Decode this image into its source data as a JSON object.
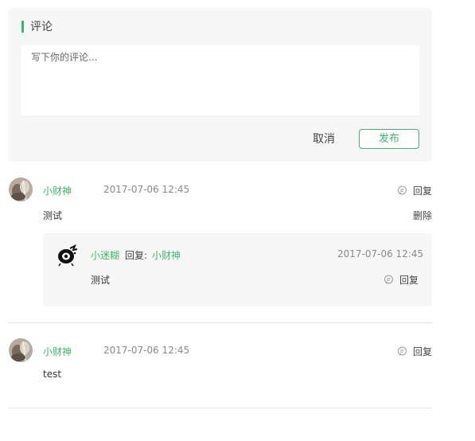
{
  "editor": {
    "title": "评论",
    "placeholder": "写下你的评论...",
    "cancel_label": "取消",
    "publish_label": "发布"
  },
  "comments": [
    {
      "username": "小财神",
      "time": "2017-07-06 12:45",
      "reply_label": "回复",
      "content": "测试",
      "delete_label": "删除",
      "replies": [
        {
          "username": "小迷糊",
          "reply_to_label": "回复:",
          "reply_to_user": "小财神",
          "time": "2017-07-06 12:45",
          "content": "测试",
          "reply_label": "回复"
        }
      ]
    },
    {
      "username": "小财神",
      "time": "2017-07-06 12:45",
      "reply_label": "回复",
      "content": "test"
    }
  ],
  "colors": {
    "accent": "#3fb56b",
    "panel_bg": "#f7f7f7",
    "divider": "#e6e6e6"
  },
  "icons": {
    "reply": "speech-bubble-icon",
    "avatar_user1": "avatar-photo",
    "avatar_user2": "avatar-cartoon"
  }
}
